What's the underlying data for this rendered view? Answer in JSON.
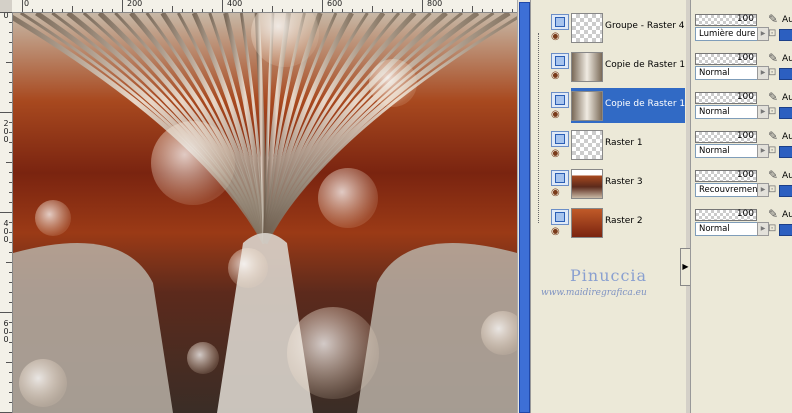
{
  "rulers": {
    "top_labels": [
      "0",
      "200",
      "400",
      "600",
      "800"
    ],
    "left_labels": [
      "0",
      "2\n0\n0",
      "4\n0\n0",
      "6\n0\n0"
    ]
  },
  "layers": [
    {
      "name": "Groupe - Raster 4",
      "selected": false,
      "thumb": "checker"
    },
    {
      "name": "Copie de Raster 1",
      "selected": false,
      "thumb": "art"
    },
    {
      "name": "Copie de Raster 1",
      "selected": true,
      "thumb": "art"
    },
    {
      "name": "Raster 1",
      "selected": false,
      "thumb": "checker"
    },
    {
      "name": "Raster 3",
      "selected": false,
      "thumb": "art2"
    },
    {
      "name": "Raster 2",
      "selected": false,
      "thumb": "rust"
    }
  ],
  "props": [
    {
      "opacity": "100",
      "blend": "Lumière dure",
      "au": "Au"
    },
    {
      "opacity": "100",
      "blend": "Normal",
      "au": "Au"
    },
    {
      "opacity": "100",
      "blend": "Normal",
      "au": "Au"
    },
    {
      "opacity": "100",
      "blend": "Normal",
      "au": "Au"
    },
    {
      "opacity": "100",
      "blend": "Recouvrement",
      "au": "Au"
    },
    {
      "opacity": "100",
      "blend": "Normal",
      "au": "Au"
    }
  ],
  "watermark": {
    "name": "Pinuccia",
    "url": "www.maidiregrafica.eu"
  },
  "colors": {
    "selection": "#316ac5",
    "panel": "#ece9d8",
    "rust": "#a8491f"
  }
}
